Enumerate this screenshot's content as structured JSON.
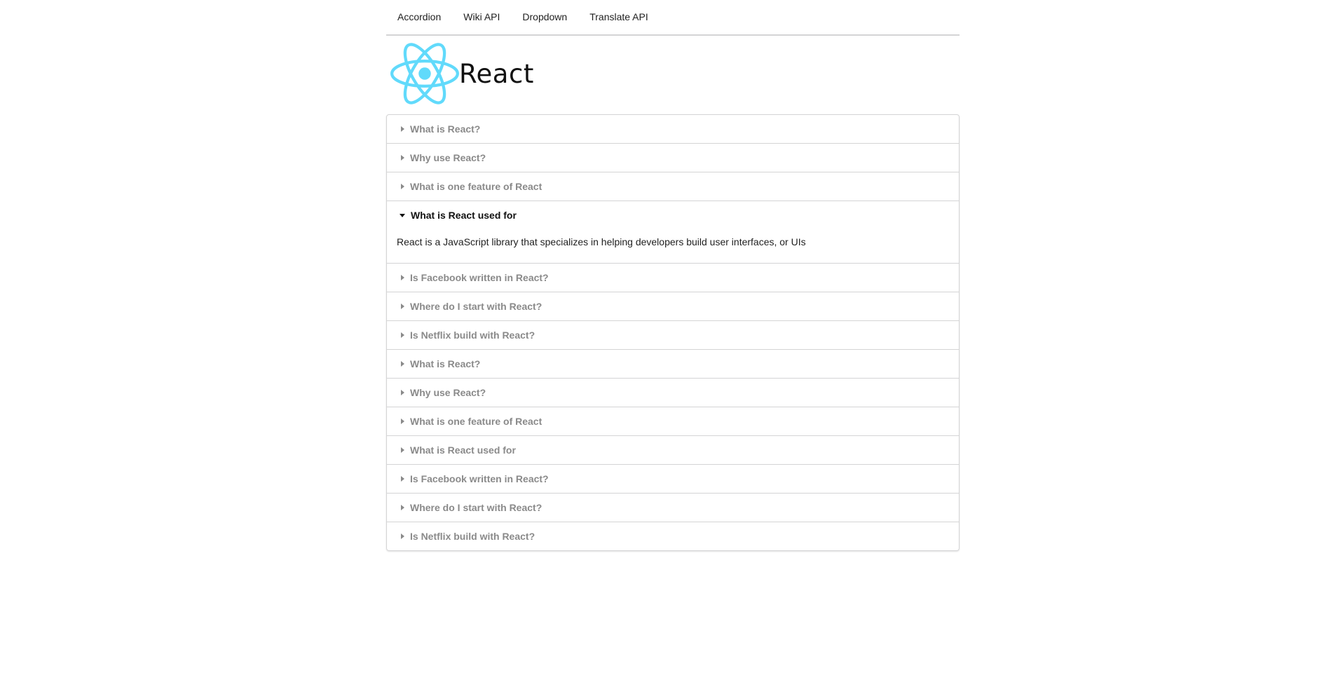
{
  "nav": {
    "items": [
      "Accordion",
      "Wiki API",
      "Dropdown",
      "Translate API"
    ]
  },
  "logo": {
    "text": "React",
    "icon": "react-atom-icon",
    "color": "#61dafb"
  },
  "accordion": {
    "active_index": 3,
    "items": [
      {
        "title": "What is React?"
      },
      {
        "title": "Why use React?"
      },
      {
        "title": "What is one feature of React"
      },
      {
        "title": "What is React used for",
        "content": "React is a JavaScript library that specializes in helping developers build user interfaces, or UIs"
      },
      {
        "title": "Is Facebook written in React?"
      },
      {
        "title": "Where do I start with React?"
      },
      {
        "title": "Is Netflix build with React?"
      },
      {
        "title": "What is React?"
      },
      {
        "title": "Why use React?"
      },
      {
        "title": "What is one feature of React"
      },
      {
        "title": "What is React used for"
      },
      {
        "title": "Is Facebook written in React?"
      },
      {
        "title": "Where do I start with React?"
      },
      {
        "title": "Is Netflix build with React?"
      }
    ]
  }
}
